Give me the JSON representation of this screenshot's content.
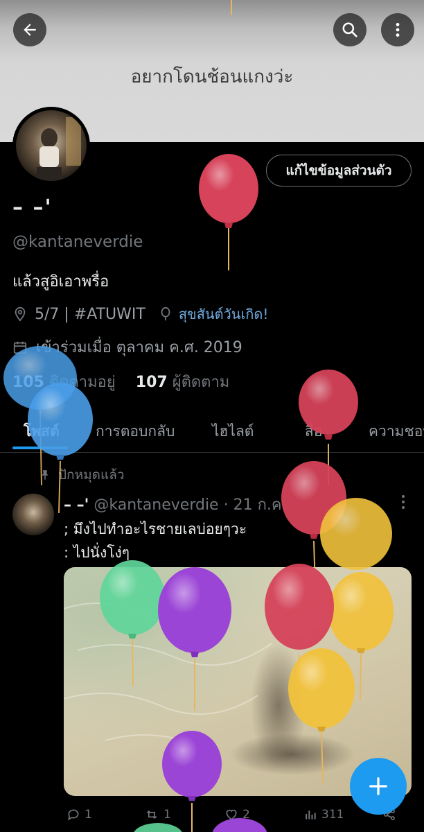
{
  "header": {
    "banner_text": "อยากโดนช้อนแกงว่ะ",
    "back_icon": "arrow-left-icon",
    "search_icon": "search-icon",
    "more_icon": "more-vertical-icon"
  },
  "profile": {
    "edit_button_label": "แก้ไขข้อมูลส่วนตัว",
    "display_name": "– –'",
    "handle": "@kantaneverdie",
    "bio": "แล้วสูอิเอาพรื่อ",
    "location": "5/7 | #ATUWIT",
    "birthday_text": "สุขสันต์วันเกิด!",
    "joined": "เข้าร่วมเมื่อ ตุลาคม ค.ศ. 2019",
    "following_count": "105",
    "following_label": "ติดตามอยู่",
    "followers_count": "107",
    "followers_label": "ผู้ติดตาม"
  },
  "tabs": [
    {
      "label": "โพสต์"
    },
    {
      "label": "การตอบกลับ"
    },
    {
      "label": "ไฮไลต์"
    },
    {
      "label": "สื่อ"
    },
    {
      "label": "ความชอบ"
    }
  ],
  "post": {
    "pinned_label": "ปักหมุดแล้ว",
    "author_name": "– –'",
    "author_handle": "@kantaneverdie",
    "date": "· 21 ก.ค.",
    "line1": "; มึงไปทำอะไรชายเลบ่อยๆวะ",
    "line2": ": ไปนั่งโง่ๆ",
    "replies": "1",
    "reposts": "1",
    "likes": "2",
    "views": "311"
  },
  "colors": {
    "accent": "#1d9bf0",
    "link": "#6fa8dc",
    "balloon_red": "#d6435a",
    "balloon_yellow": "#f2c23c",
    "balloon_purple": "#9b45d6",
    "balloon_green": "#5fd69a",
    "balloon_blue": "#4a9ee8"
  }
}
